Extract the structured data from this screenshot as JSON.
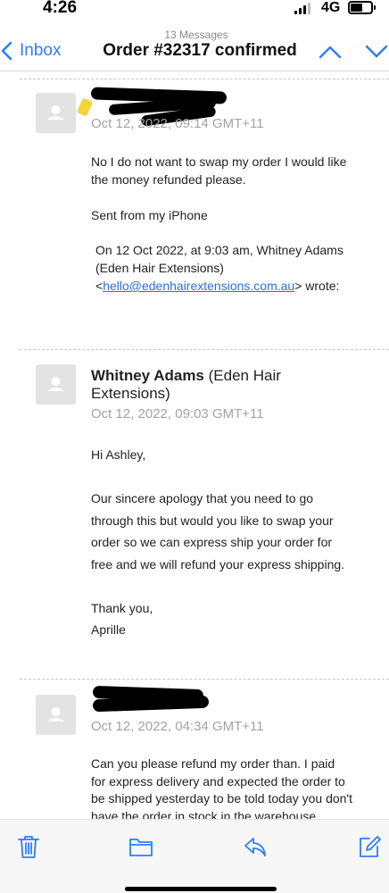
{
  "status_bar": {
    "time": "4:26",
    "network": "4G"
  },
  "nav": {
    "back_label": "Inbox",
    "message_count": "13 Messages",
    "subject": "Order #32317 confirmed"
  },
  "messages": [
    {
      "sender": "",
      "date": "Oct 12, 2022, 09:14 GMT+11",
      "lines": [
        "No I do not want to swap my order I would like",
        "the money refunded please.",
        "Sent from my iPhone"
      ],
      "quote_lines": [
        "On 12 Oct 2022, at 9:03 am, Whitney Adams",
        "(Eden Hair Extensions)"
      ],
      "quote_link_prefix": "<",
      "quote_link": "hello@edenhairextensions.com.au",
      "quote_link_suffix": "> wrote:"
    },
    {
      "sender_name": "Whitney Adams",
      "sender_org_1": "(Eden Hair",
      "sender_org_2": "Extensions)",
      "date": "Oct 12, 2022, 09:03 GMT+11",
      "greeting": "Hi Ashley,",
      "lines": [
        "Our sincere apology that you need to go",
        "through this but would you like to swap your",
        "order so we can express ship your order for",
        "free and we will refund your express shipping."
      ],
      "signoff": [
        "Thank you,",
        "Aprille"
      ]
    },
    {
      "sender": "",
      "date": "Oct 12, 2022, 04:34 GMT+11",
      "lines": [
        "Can you please refund my order than. I paid",
        "for express delivery and expected the order to",
        "be shipped yesterday to be told today you don't",
        "have the order in stock in the warehouse."
      ]
    }
  ],
  "toolbar": {
    "icons": [
      "trash-icon",
      "folder-icon",
      "reply-icon",
      "compose-icon"
    ]
  },
  "colors": {
    "accent": "#2f7cf6",
    "date_gray": "#a3a3a3",
    "link": "#2b6fd6"
  }
}
